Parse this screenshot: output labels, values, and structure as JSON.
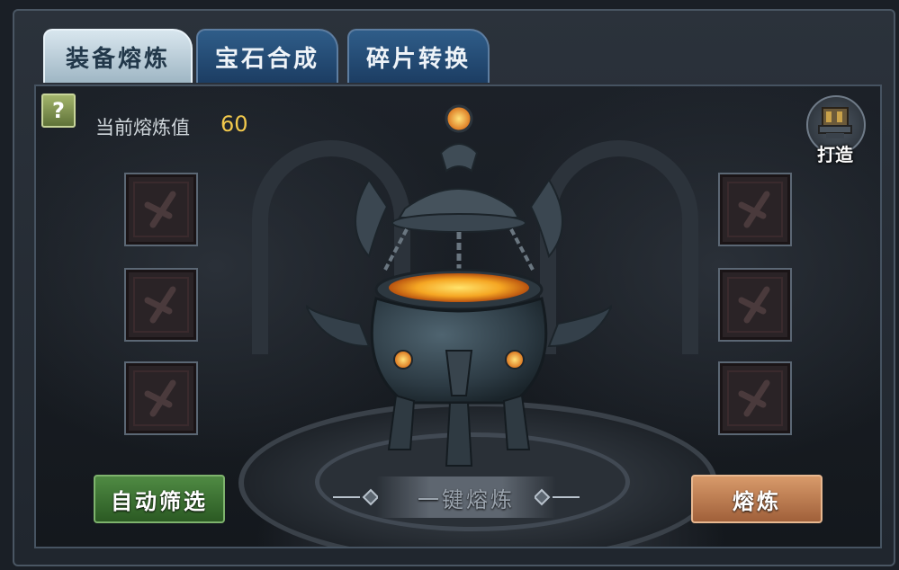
{
  "tabs": [
    {
      "label": "装备熔炼",
      "active": true
    },
    {
      "label": "宝石合成",
      "active": false
    },
    {
      "label": "碎片转换",
      "active": false
    }
  ],
  "help": {
    "label": "?"
  },
  "smelt_value": {
    "label": "当前熔炼值",
    "value": "60"
  },
  "forge": {
    "label": "打造",
    "icon": "anvil-icon"
  },
  "slots": {
    "left": [
      {
        "icon": "sword-placeholder-icon"
      },
      {
        "icon": "sword-placeholder-icon"
      },
      {
        "icon": "sword-placeholder-icon"
      }
    ],
    "right": [
      {
        "icon": "sword-placeholder-icon"
      },
      {
        "icon": "sword-placeholder-icon"
      },
      {
        "icon": "sword-placeholder-icon"
      }
    ]
  },
  "buttons": {
    "auto_filter": "自动筛选",
    "one_key_smelt": "一键熔炼",
    "smelt": "熔炼"
  },
  "colors": {
    "accent_value": "#f2c94c",
    "auto_button": "#3d7a34",
    "smelt_button": "#c07a4f",
    "tab_active": "#b9cdd8",
    "tab_inactive": "#244a73"
  }
}
